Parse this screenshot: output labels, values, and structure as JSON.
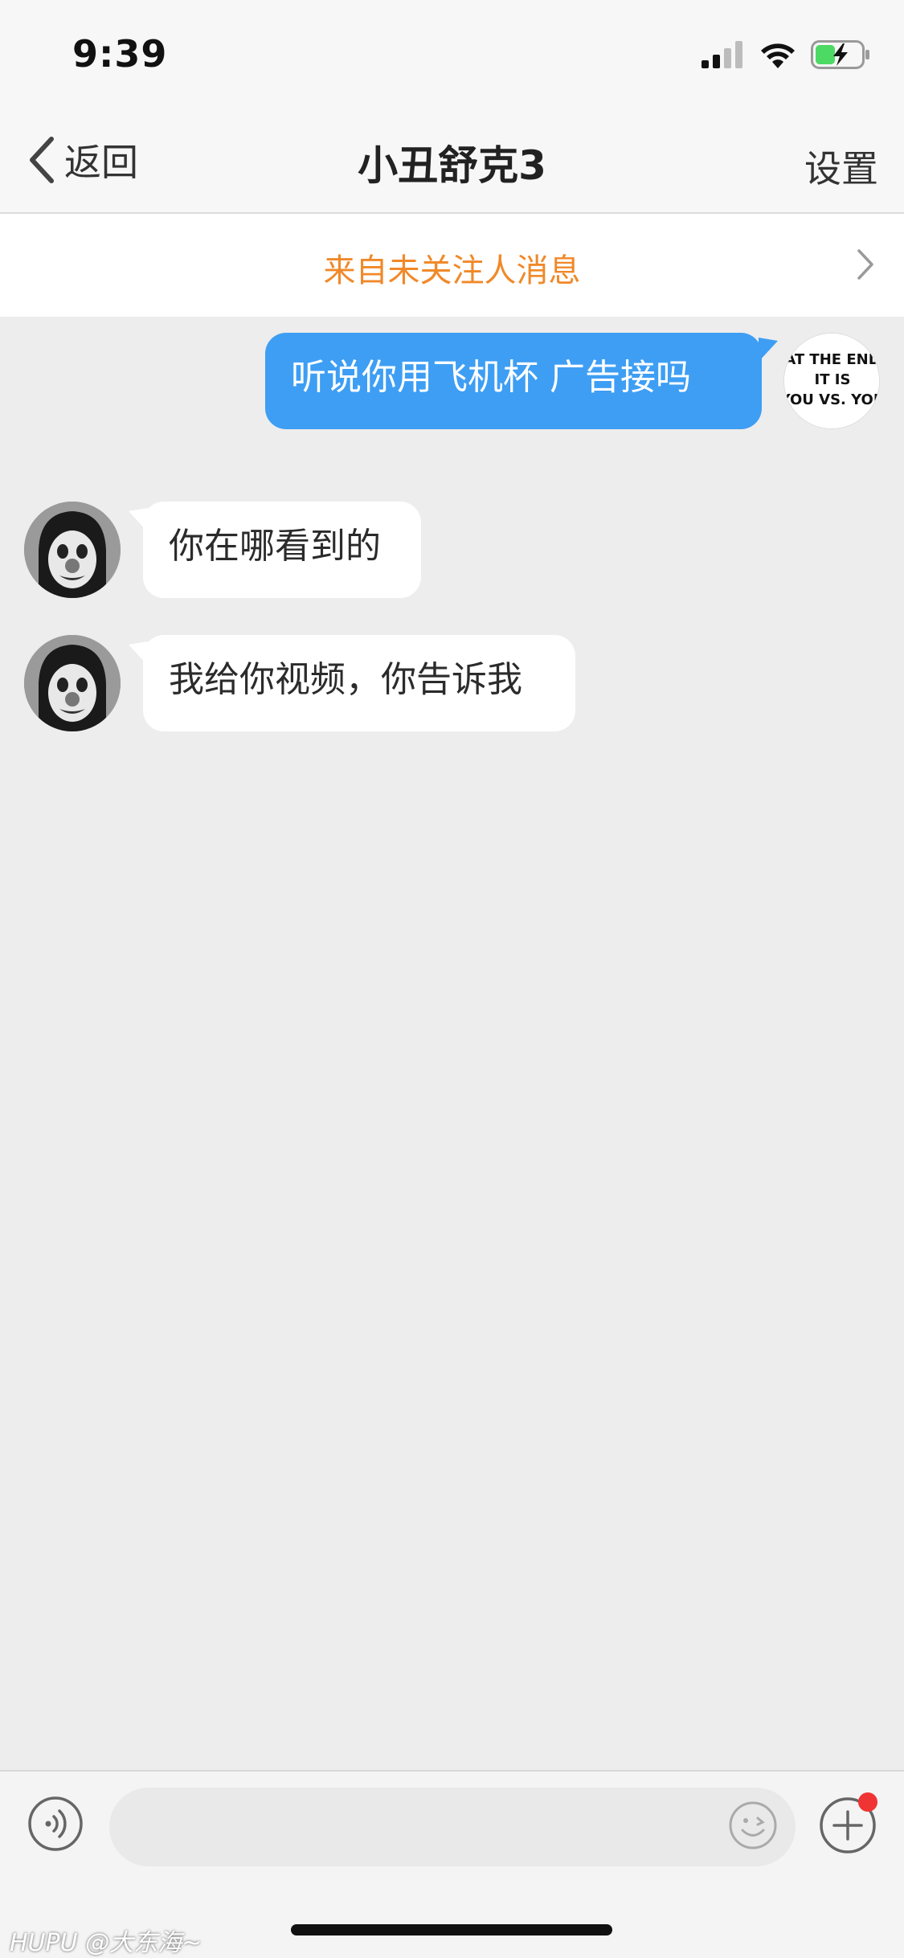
{
  "status_bar": {
    "time": "9:39",
    "icons": [
      "cellular-signal-icon",
      "wifi-icon",
      "battery-charging-icon"
    ],
    "battery_color": "#4cd964"
  },
  "nav": {
    "back_label": "返回",
    "title": "小丑舒克3",
    "settings_label": "设置"
  },
  "banner": {
    "text": "来自未关注人消息",
    "color": "#f0892a"
  },
  "messages": [
    {
      "direction": "outgoing",
      "text": "听说你用飞机杯  广告接吗",
      "avatar_text": [
        "AT THE END",
        "IT IS",
        "YOU VS. YOU"
      ]
    },
    {
      "direction": "incoming",
      "text": "你在哪看到的"
    },
    {
      "direction": "incoming",
      "text": "我给你视频，你告诉我"
    }
  ],
  "input_bar": {
    "placeholder": "",
    "icons": [
      "voice-icon",
      "emoji-icon",
      "plus-icon"
    ]
  },
  "watermark": "HUPU @大东海~",
  "colors": {
    "outgoing_bubble": "#3e9ef4",
    "incoming_bubble": "#ffffff",
    "chat_background": "#ededed",
    "notification_dot": "#f03434"
  }
}
